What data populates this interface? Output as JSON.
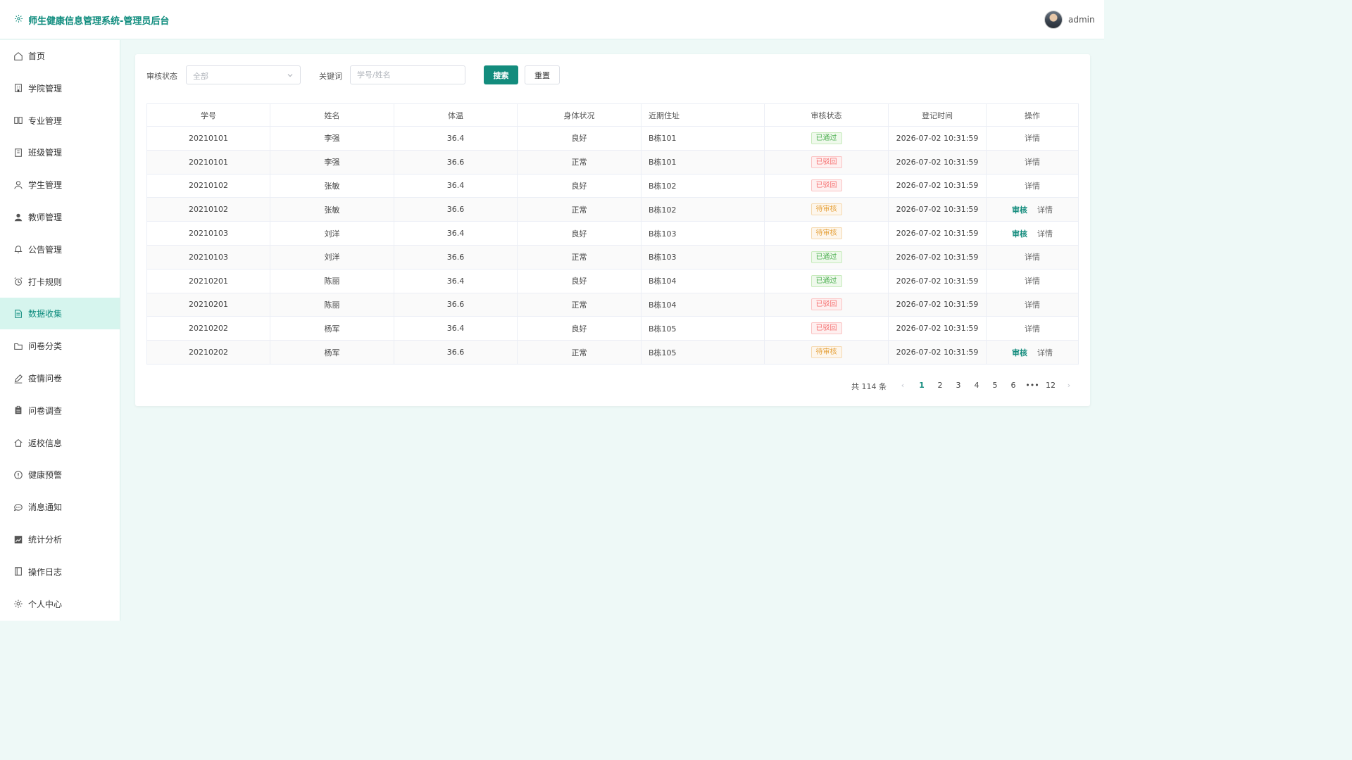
{
  "header": {
    "title": "师生健康信息管理系统-管理员后台",
    "user": "admin"
  },
  "sidebar": {
    "items": [
      {
        "label": "首页",
        "icon": "home-icon"
      },
      {
        "label": "学院管理",
        "icon": "building-icon"
      },
      {
        "label": "专业管理",
        "icon": "book-icon"
      },
      {
        "label": "班级管理",
        "icon": "notebook-icon"
      },
      {
        "label": "学生管理",
        "icon": "user-icon"
      },
      {
        "label": "教师管理",
        "icon": "user-filled-icon"
      },
      {
        "label": "公告管理",
        "icon": "bell-icon"
      },
      {
        "label": "打卡规则",
        "icon": "alarm-clock-icon"
      },
      {
        "label": "数据收集",
        "icon": "document-icon",
        "active": true
      },
      {
        "label": "问卷分类",
        "icon": "folder-icon"
      },
      {
        "label": "疫情问卷",
        "icon": "edit-pen-icon"
      },
      {
        "label": "问卷调查",
        "icon": "clipboard-icon"
      },
      {
        "label": "返校信息",
        "icon": "house-icon"
      },
      {
        "label": "健康预警",
        "icon": "warning-circle-icon"
      },
      {
        "label": "消息通知",
        "icon": "chat-icon"
      },
      {
        "label": "统计分析",
        "icon": "trend-chart-icon"
      },
      {
        "label": "操作日志",
        "icon": "log-book-icon"
      },
      {
        "label": "个人中心",
        "icon": "gear-icon"
      }
    ]
  },
  "filters": {
    "status_label": "审核状态",
    "status_value": "全部",
    "keyword_label": "关键词",
    "keyword_placeholder": "学号/姓名",
    "search_button": "搜索",
    "reset_button": "重置"
  },
  "table": {
    "columns": [
      "学号",
      "姓名",
      "体温",
      "身体状况",
      "近期住址",
      "审核状态",
      "登记时间",
      "操作"
    ],
    "audit_label": "审核",
    "detail_label": "详情",
    "rows": [
      {
        "id": "20210101",
        "name": "李强",
        "temp": "36.4",
        "health": "良好",
        "address": "B栋101",
        "status": "已通过",
        "status_type": "pass",
        "time": "2026-07-02 10:31:59"
      },
      {
        "id": "20210101",
        "name": "李强",
        "temp": "36.6",
        "health": "正常",
        "address": "B栋101",
        "status": "已驳回",
        "status_type": "reject",
        "time": "2026-07-02 10:31:59"
      },
      {
        "id": "20210102",
        "name": "张敏",
        "temp": "36.4",
        "health": "良好",
        "address": "B栋102",
        "status": "已驳回",
        "status_type": "reject",
        "time": "2026-07-02 10:31:59"
      },
      {
        "id": "20210102",
        "name": "张敏",
        "temp": "36.6",
        "health": "正常",
        "address": "B栋102",
        "status": "待审核",
        "status_type": "pending",
        "time": "2026-07-02 10:31:59"
      },
      {
        "id": "20210103",
        "name": "刘洋",
        "temp": "36.4",
        "health": "良好",
        "address": "B栋103",
        "status": "待审核",
        "status_type": "pending",
        "time": "2026-07-02 10:31:59"
      },
      {
        "id": "20210103",
        "name": "刘洋",
        "temp": "36.6",
        "health": "正常",
        "address": "B栋103",
        "status": "已通过",
        "status_type": "pass",
        "time": "2026-07-02 10:31:59"
      },
      {
        "id": "20210201",
        "name": "陈丽",
        "temp": "36.4",
        "health": "良好",
        "address": "B栋104",
        "status": "已通过",
        "status_type": "pass",
        "time": "2026-07-02 10:31:59"
      },
      {
        "id": "20210201",
        "name": "陈丽",
        "temp": "36.6",
        "health": "正常",
        "address": "B栋104",
        "status": "已驳回",
        "status_type": "reject",
        "time": "2026-07-02 10:31:59"
      },
      {
        "id": "20210202",
        "name": "杨军",
        "temp": "36.4",
        "health": "良好",
        "address": "B栋105",
        "status": "已驳回",
        "status_type": "reject",
        "time": "2026-07-02 10:31:59"
      },
      {
        "id": "20210202",
        "name": "杨军",
        "temp": "36.6",
        "health": "正常",
        "address": "B栋105",
        "status": "待审核",
        "status_type": "pending",
        "time": "2026-07-02 10:31:59"
      }
    ]
  },
  "pagination": {
    "total": "共 114 条",
    "pages": [
      "1",
      "2",
      "3",
      "4",
      "5",
      "6",
      "•••",
      "12"
    ],
    "current": "1"
  },
  "colors": {
    "accent": "#138c7d",
    "title": "#0f8c7e",
    "active_bg": "#d6f5ee",
    "pass": "#4caf50",
    "reject": "#f56c6c",
    "pending": "#e6a23c"
  }
}
